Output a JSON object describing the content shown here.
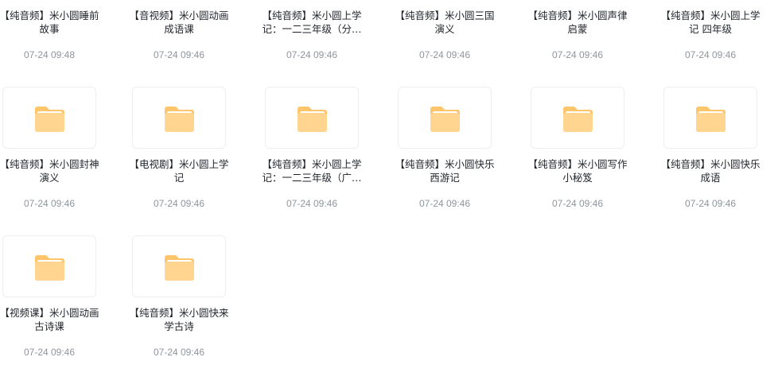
{
  "colors": {
    "folder_back": "#ffc56a",
    "folder_front": "#ffd58f",
    "folder_paper": "#ffffff",
    "name_text": "#1f2329",
    "date_text": "#8f959e",
    "thumb_border": "#eceef2"
  },
  "folders": [
    {
      "name": "【纯音频】米小圆睡前故事",
      "date": "07-24 09:48",
      "icon": "folder-icon"
    },
    {
      "name": "【音视频】米小圆动画成语课",
      "date": "07-24 09:46",
      "icon": "folder-icon"
    },
    {
      "name": "【纯音频】米小圆上学记：一二三年级（分…",
      "date": "07-24 09:46",
      "icon": "folder-icon"
    },
    {
      "name": "【纯音频】米小圆三国演义",
      "date": "07-24 09:46",
      "icon": "folder-icon"
    },
    {
      "name": "【纯音频】米小圆声律启蒙",
      "date": "07-24 09:46",
      "icon": "folder-icon"
    },
    {
      "name": "【纯音频】米小圆上学记 四年级",
      "date": "07-24 09:46",
      "icon": "folder-icon"
    },
    {
      "name": "【纯音频】米小圆封神演义",
      "date": "07-24 09:46",
      "icon": "folder-icon"
    },
    {
      "name": "【电视剧】米小圆上学记",
      "date": "07-24 09:46",
      "icon": "folder-icon"
    },
    {
      "name": "【纯音频】米小圆上学记：一二三年级（广…",
      "date": "07-24 09:46",
      "icon": "folder-icon"
    },
    {
      "name": "【纯音频】米小圆快乐西游记",
      "date": "07-24 09:46",
      "icon": "folder-icon"
    },
    {
      "name": "【纯音频】米小圆写作小秘笈",
      "date": "07-24 09:46",
      "icon": "folder-icon"
    },
    {
      "name": "【纯音频】米小圆快乐成语",
      "date": "07-24 09:46",
      "icon": "folder-icon"
    },
    {
      "name": "【视频课】米小圆动画古诗课",
      "date": "07-24 09:46",
      "icon": "folder-icon"
    },
    {
      "name": "【纯音频】米小圆快来学古诗",
      "date": "07-24 09:46",
      "icon": "folder-icon"
    }
  ]
}
